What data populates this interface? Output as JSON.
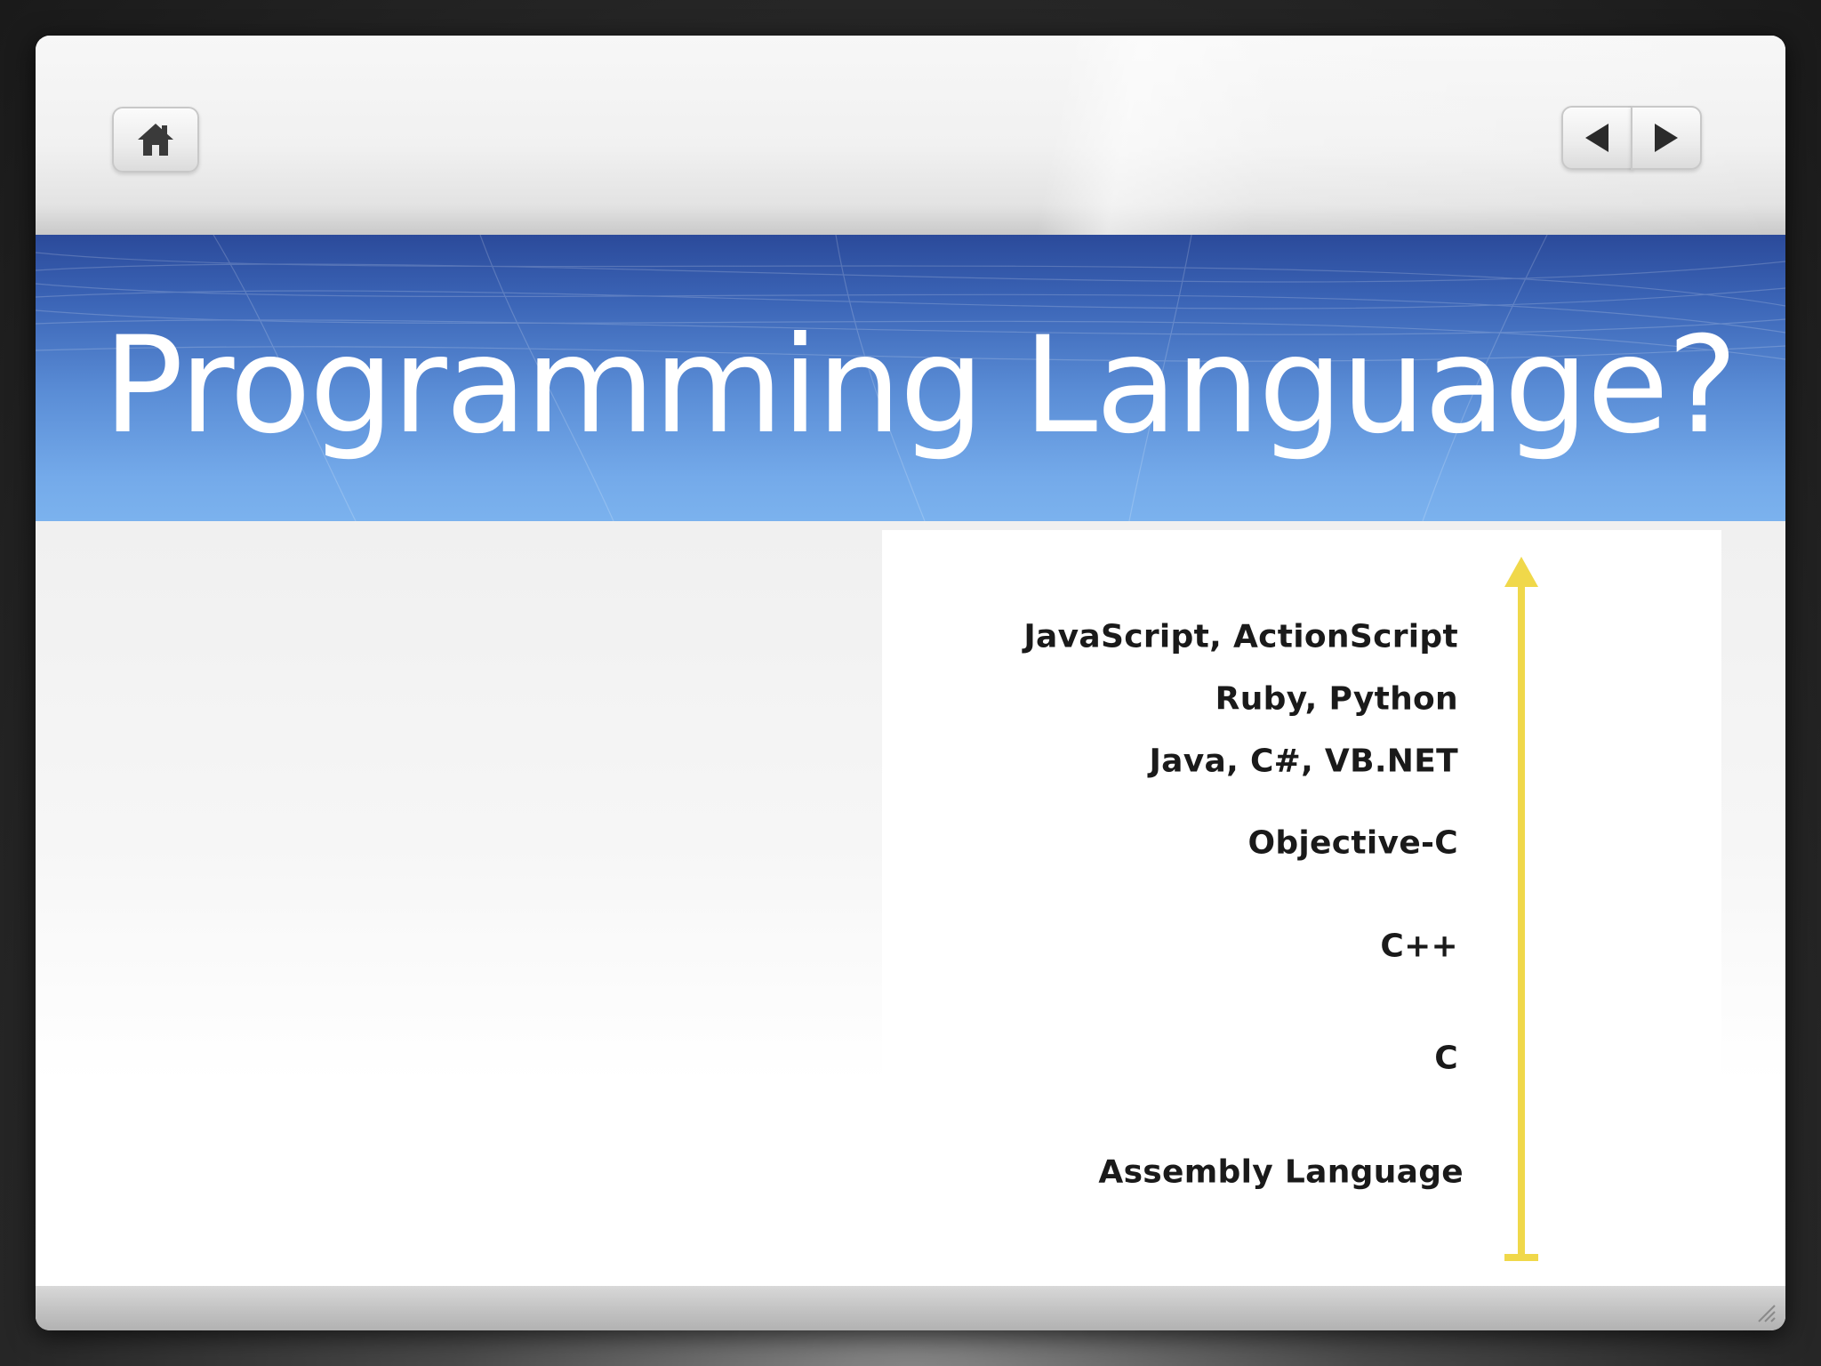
{
  "toolbar": {
    "home_icon": "home-icon",
    "prev_icon": "triangle-left-icon",
    "next_icon": "triangle-right-icon"
  },
  "slide": {
    "title": "Programming Language?"
  },
  "diagram": {
    "languages": [
      "JavaScript, ActionScript",
      "Ruby, Python",
      "Java, C#, VB.NET",
      "Objective-C",
      "C++",
      "C",
      "Assembly Language"
    ],
    "arrow_color": "#f0d84a"
  },
  "colors": {
    "title_band_top": "#2b4a9a",
    "title_band_bottom": "#7bb2ee",
    "title_text": "#ffffff"
  }
}
